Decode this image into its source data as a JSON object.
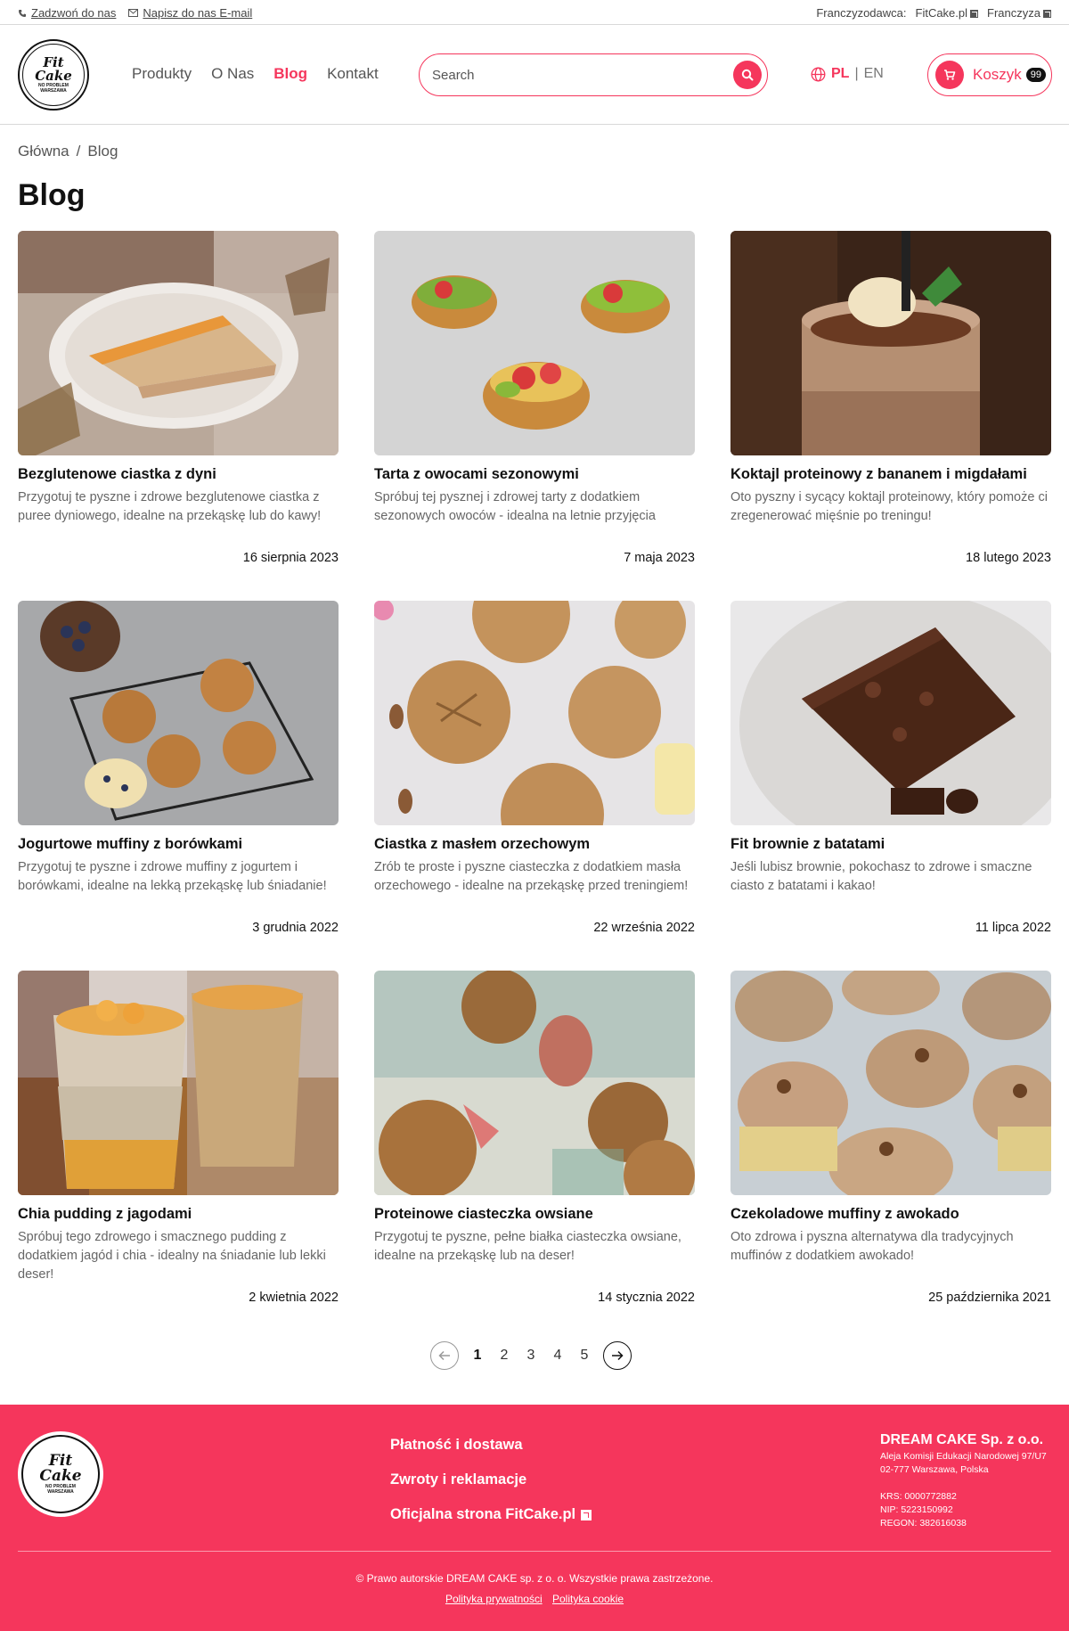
{
  "topbar": {
    "call": "Zadzwoń do nas",
    "email": "Napisz do nas E-mail",
    "franchisor_label": "Franczyzodawca:",
    "franchisor_link": "FitCake.pl",
    "franchise_link": "Franczyza"
  },
  "logo": {
    "line1": "Fit",
    "line2": "Cake",
    "tagline": "NO PROBLEM",
    "city": "WARSZAWA"
  },
  "nav": {
    "items": [
      {
        "label": "Produkty",
        "active": false
      },
      {
        "label": "O Nas",
        "active": false
      },
      {
        "label": "Blog",
        "active": true
      },
      {
        "label": "Kontakt",
        "active": false
      }
    ]
  },
  "search": {
    "placeholder": "Search"
  },
  "lang": {
    "pl": "PL",
    "sep": "|",
    "en": "EN"
  },
  "cart": {
    "label": "Koszyk",
    "count": "99"
  },
  "breadcrumb": {
    "home": "Główna",
    "sep": "/",
    "current": "Blog"
  },
  "page_title": "Blog",
  "posts": [
    {
      "title": "Bezglutenowe ciastka z dyni",
      "excerpt": "Przygotuj te pyszne i zdrowe bezglutenowe ciastka z puree dyniowego, idealne na przekąskę lub do kawy!",
      "date": "16 sierpnia 2023",
      "image": "pumpkin-cake-photo"
    },
    {
      "title": "Tarta z owocami sezonowymi",
      "excerpt": "Spróbuj tej pysznej i zdrowej tarty z dodatkiem sezonowych owoców - idealna na letnie przyjęcia",
      "date": "7 maja 2023",
      "image": "fruit-tart-photo"
    },
    {
      "title": "Koktajl proteinowy z bananem i migdałami",
      "excerpt": "Oto pyszny i sycący koktajl proteinowy, który pomoże ci zregenerować mięśnie po treningu!",
      "date": "18 lutego 2023",
      "image": "protein-shake-photo"
    },
    {
      "title": "Jogurtowe muffiny z borówkami",
      "excerpt": "Przygotuj te pyszne i zdrowe muffiny z jogurtem i borówkami, idealne na lekką przekąskę lub śniadanie!",
      "date": "3 grudnia 2022",
      "image": "blueberry-muffins-photo"
    },
    {
      "title": "Ciastka z masłem orzechowym",
      "excerpt": "Zrób te proste i pyszne ciasteczka z dodatkiem masła orzechowego - idealne na przekąskę przed treningiem!",
      "date": "22 września 2022",
      "image": "peanut-cookies-photo"
    },
    {
      "title": "Fit brownie z batatami",
      "excerpt": "Jeśli lubisz brownie, pokochasz to zdrowe i smaczne ciasto z batatami i kakao!",
      "date": "11 lipca 2022",
      "image": "brownie-photo"
    },
    {
      "title": "Chia pudding z jagodami",
      "excerpt": "Spróbuj tego zdrowego i smacznego pudding z dodatkiem jagód i chia - idealny na śniadanie lub lekki deser!",
      "date": "2 kwietnia 2022",
      "image": "chia-pudding-photo"
    },
    {
      "title": "Proteinowe ciasteczka owsiane",
      "excerpt": "Przygotuj te pyszne, pełne białka ciasteczka owsiane, idealne na przekąskę lub na deser!",
      "date": "14 stycznia 2022",
      "image": "oat-cookies-photo"
    },
    {
      "title": "Czekoladowe muffiny z awokado",
      "excerpt": "Oto zdrowa i pyszna alternatywa dla tradycyjnych muffinów z dodatkiem awokado!",
      "date": "25 października 2021",
      "image": "chocolate-cupcakes-photo"
    }
  ],
  "pagination": {
    "pages": [
      "1",
      "2",
      "3",
      "4",
      "5"
    ],
    "current": "1"
  },
  "footer": {
    "links": [
      "Płatność i dostawa",
      "Zwroty i reklamacje",
      "Oficjalna strona FitCake.pl"
    ],
    "company": {
      "name": "DREAM CAKE Sp. z o.o.",
      "address1": "Aleja Komisji Edukacji Narodowej 97/U7",
      "address2": "02-777 Warszawa, Polska",
      "krs": "KRS: 0000772882",
      "nip": "NIP: 5223150992",
      "regon": "REGON: 382616038"
    },
    "copyright": "© Prawo autorskie DREAM CAKE sp. z o. o. Wszystkie prawa zastrzeżone.",
    "privacy": "Polityka prywatności",
    "cookie": "Polityka cookie"
  },
  "colors": {
    "accent": "#f5365c",
    "text": "#111111",
    "muted": "#666666"
  }
}
